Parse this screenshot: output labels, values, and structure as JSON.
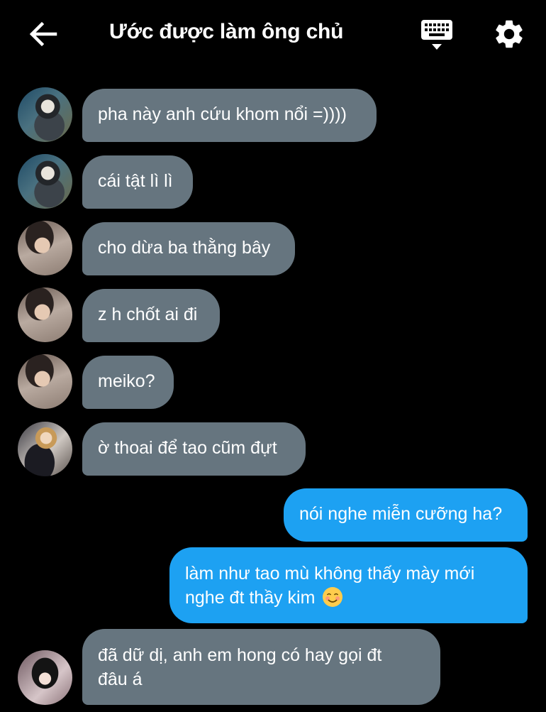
{
  "header": {
    "title": "Ước được làm ông chủ",
    "back_icon": "arrow-left-icon",
    "keyboard_icon": "keyboard-icon",
    "settings_icon": "gear-icon"
  },
  "messages": [
    {
      "direction": "incoming",
      "sender_avatar": "avatar-a",
      "text": "pha này anh cứu khom nổi =))))"
    },
    {
      "direction": "incoming",
      "sender_avatar": "avatar-a",
      "text": "cái tật lì lì"
    },
    {
      "direction": "incoming",
      "sender_avatar": "avatar-b",
      "text": "cho dừa ba thằng bây"
    },
    {
      "direction": "incoming",
      "sender_avatar": "avatar-b",
      "text": "z h chốt ai đi"
    },
    {
      "direction": "incoming",
      "sender_avatar": "avatar-b",
      "text": "meiko?"
    },
    {
      "direction": "incoming",
      "sender_avatar": "avatar-c",
      "text": "ờ thoai để tao cũm đựt"
    },
    {
      "direction": "outgoing",
      "text": "nói nghe miễn cưỡng ha?"
    },
    {
      "direction": "outgoing",
      "line1": "làm như tao mù không thấy mày mới",
      "line2": "nghe đt thầy kim",
      "emoji": "smiling-face-icon"
    },
    {
      "direction": "incoming",
      "sender_avatar": "avatar-d",
      "line1": "đã dữ dị, anh em hong có hay gọi đt",
      "line2": "đâu á"
    }
  ],
  "colors": {
    "background": "#000000",
    "incoming_bubble": "#66757f",
    "outgoing_bubble": "#1da1f2",
    "text": "#ffffff"
  }
}
